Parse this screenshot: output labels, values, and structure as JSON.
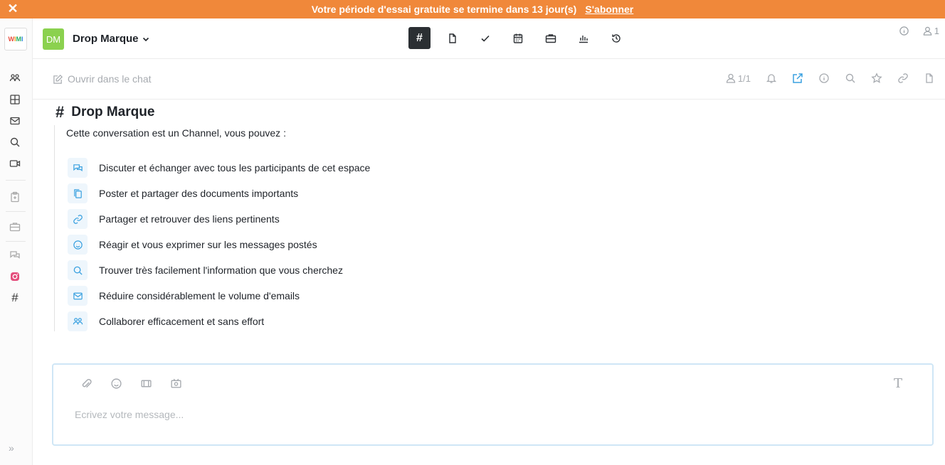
{
  "trial_banner": {
    "text": "Votre période d'essai gratuite se termine dans 13 jour(s)",
    "link": "S'abonner",
    "close_icon": "close-icon",
    "color": "#f0883a"
  },
  "sidebar": {
    "logo": [
      "W",
      "I",
      "M",
      "I"
    ],
    "items": [
      {
        "icon": "team-icon"
      },
      {
        "icon": "grid-icon"
      },
      {
        "icon": "mail-icon"
      },
      {
        "icon": "search-icon"
      },
      {
        "icon": "video-icon"
      },
      {
        "icon": "clipboard-icon"
      },
      {
        "icon": "briefcase-icon"
      },
      {
        "icon": "chat-icon"
      },
      {
        "icon": "instagram-icon"
      },
      {
        "icon": "hash-icon"
      }
    ],
    "expand_label": "»"
  },
  "header": {
    "workspace_badge": "DM",
    "workspace_name": "Drop Marque",
    "badge_color": "#8bd14f",
    "tabs": [
      {
        "icon": "hash-icon",
        "active": true
      },
      {
        "icon": "document-icon"
      },
      {
        "icon": "check-icon"
      },
      {
        "icon": "calendar-icon"
      },
      {
        "icon": "briefcase-icon"
      },
      {
        "icon": "chart-icon"
      },
      {
        "icon": "history-icon"
      }
    ],
    "members_count": "1"
  },
  "toolbar": {
    "open_chat_label": "Ouvrir dans le chat",
    "members_ratio": "1/1",
    "accent": "#3aa1e0"
  },
  "channel": {
    "title": "Drop Marque",
    "intro": "Cette conversation est un Channel, vous pouvez :",
    "features": [
      {
        "icon": "chat-icon",
        "text": "Discuter et échanger avec tous les participants de cet espace"
      },
      {
        "icon": "documents-icon",
        "text": "Poster et partager des documents importants"
      },
      {
        "icon": "link-icon",
        "text": "Partager et retrouver des liens pertinents"
      },
      {
        "icon": "smiley-icon",
        "text": "Réagir et vous exprimer sur les messages postés"
      },
      {
        "icon": "search-icon",
        "text": "Trouver très facilement l'information que vous cherchez"
      },
      {
        "icon": "mail-icon",
        "text": "Réduire considérablement le volume d'emails"
      },
      {
        "icon": "team-icon",
        "text": "Collaborer efficacement et sans effort"
      }
    ]
  },
  "composer": {
    "placeholder": "Ecrivez votre message...",
    "format_label": "T",
    "tools": [
      "attachment-icon",
      "emoji-icon",
      "gif-icon",
      "screen-record-icon"
    ]
  }
}
